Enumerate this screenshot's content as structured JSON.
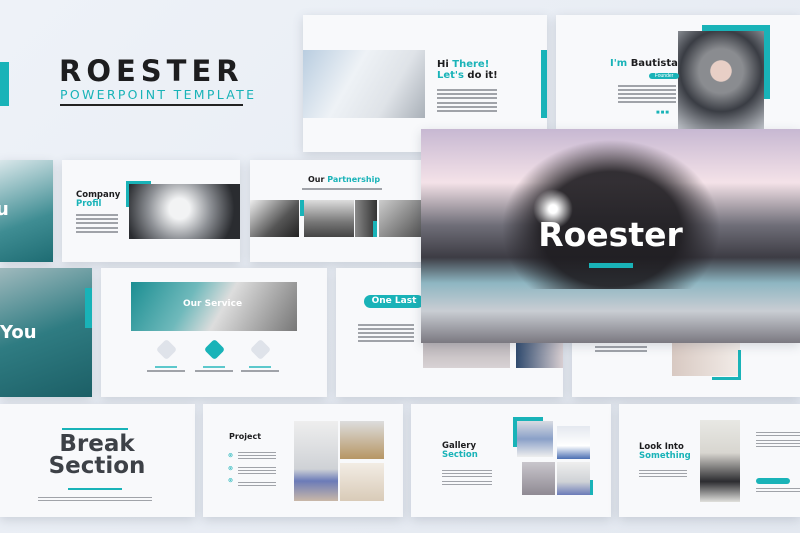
{
  "brand": {
    "title": "ROESTER",
    "subtitle": "POWERPOINT TEMPLATE",
    "accent": "#19b3b8",
    "text": "#1d1d1f"
  },
  "slides": {
    "hi": {
      "line1a": "Hi ",
      "line1b": "There!",
      "line2a": "Let's",
      "line2b": " do it!"
    },
    "bautista": {
      "a": "I'm ",
      "b": "Bautista",
      "badge": "Founder",
      "social": [
        "twitter-icon",
        "facebook-icon",
        "instagram-icon"
      ]
    },
    "left_partial_1": {
      "text": "u"
    },
    "company": {
      "a": "Company",
      "b": "Profil"
    },
    "partnership": {
      "a": "Our ",
      "b": "Partnership"
    },
    "cover": {
      "title": "Roester"
    },
    "left_partial_2": {
      "text": "You"
    },
    "service": {
      "title": "Our Service",
      "icons": [
        "binoculars-icon",
        "globe-icon",
        "flag-icon"
      ]
    },
    "one_last": {
      "title": "One Last"
    },
    "break": {
      "a": "Break",
      "b": "Section"
    },
    "project": {
      "title": "Project"
    },
    "gallery": {
      "a": "Gallery",
      "b": "Section"
    },
    "look": {
      "a": "Look Into",
      "b": "Something"
    }
  }
}
